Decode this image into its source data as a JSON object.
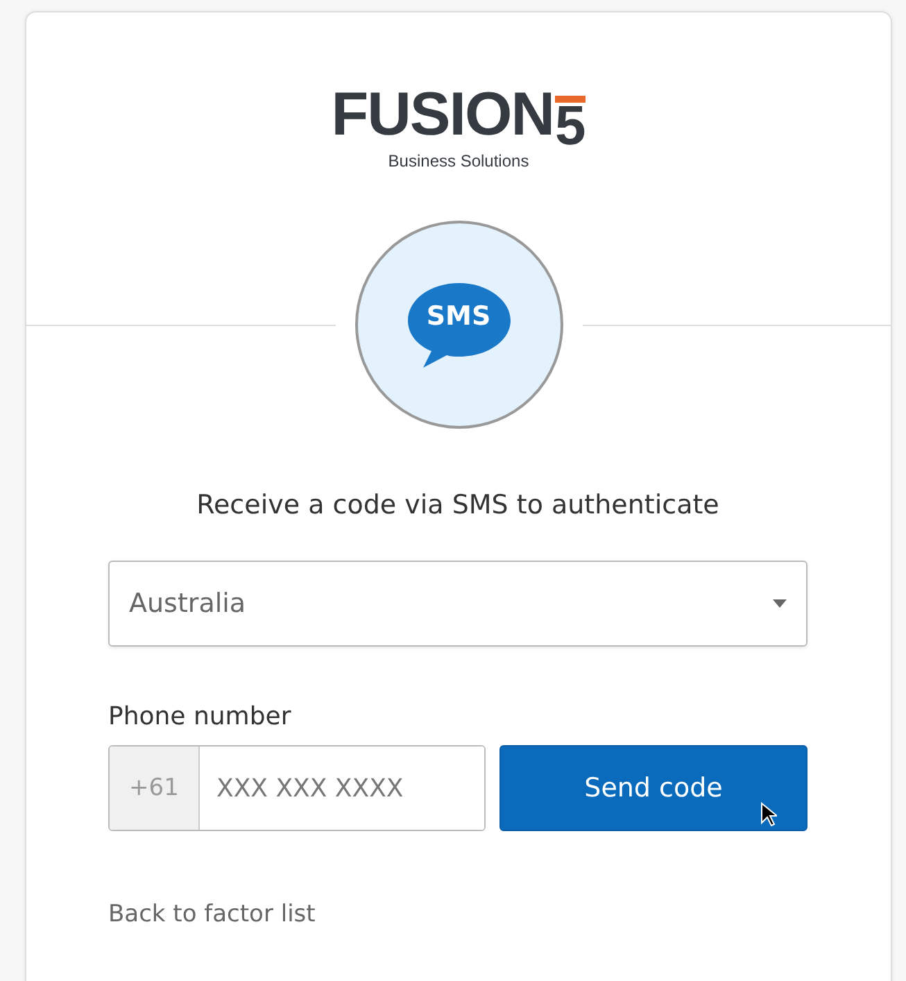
{
  "logo": {
    "wordmark": "FUSION",
    "mark": "5",
    "tagline": "Business Solutions"
  },
  "factor_badge": {
    "label": "SMS"
  },
  "heading": "Receive a code via SMS to authenticate",
  "country_select": {
    "value": "Australia"
  },
  "phone": {
    "label": "Phone number",
    "prefix": "+61",
    "placeholder": "XXX XXX XXXX"
  },
  "send_button": {
    "label": "Send code",
    "hovered": true
  },
  "back_link": "Back to factor list"
}
